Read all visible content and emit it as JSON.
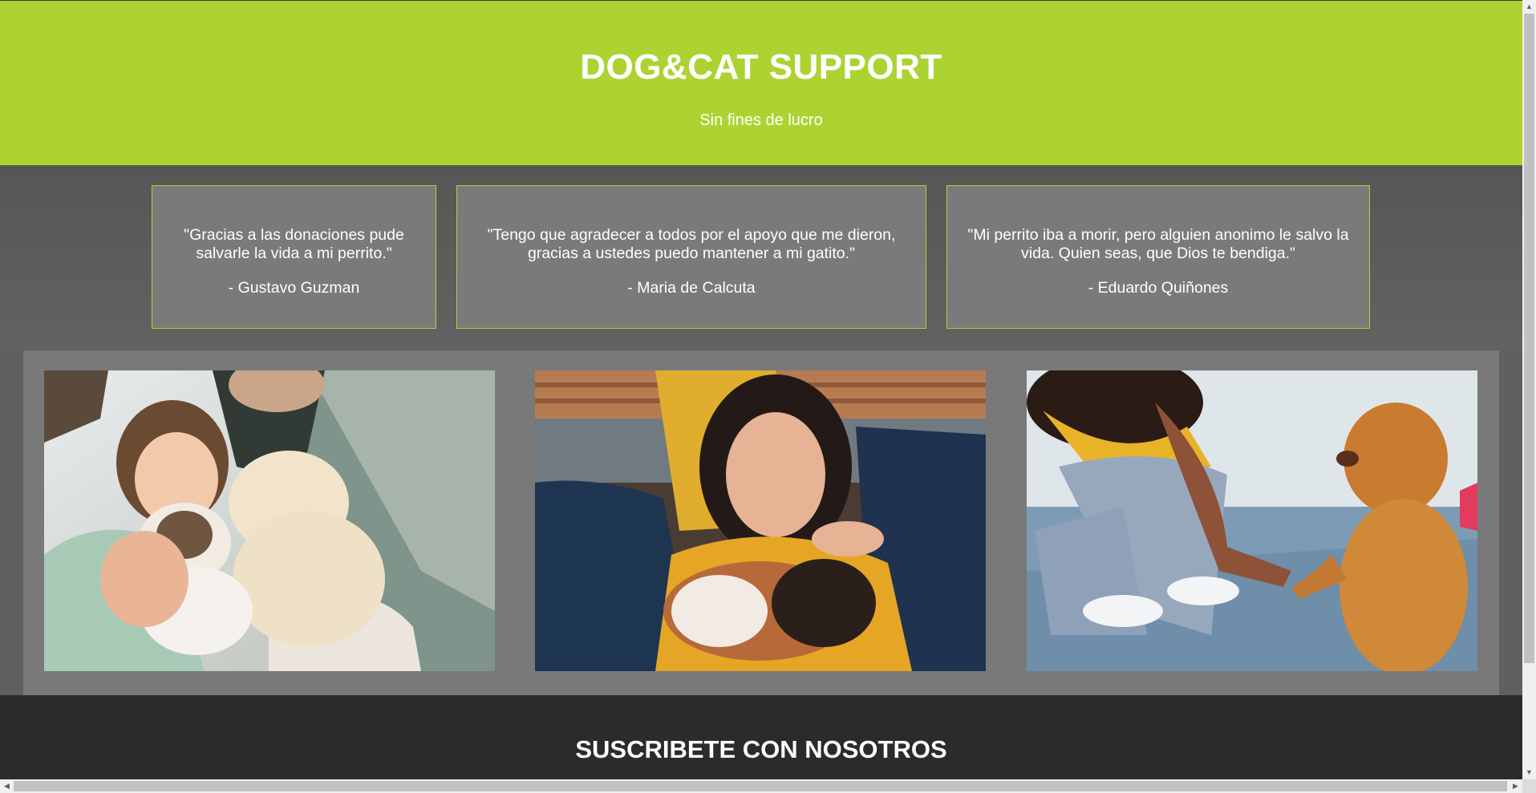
{
  "hero": {
    "title": "DOG&CAT SUPPORT",
    "subtitle": "Sin fines de lucro"
  },
  "testimonials": [
    {
      "quote": "\"Gracias a las donaciones pude salvarle la vida a mi perrito.\"",
      "author": "- Gustavo Guzman"
    },
    {
      "quote": "\"Tengo que agradecer a todos por el apoyo que me dieron, gracias a ustedes puedo mantener a mi gatito.\"",
      "author": "- Maria de Calcuta"
    },
    {
      "quote": "\"Mi perrito iba a morir, pero alguien anonimo le salvo la vida. Quien seas, que Dios te bendiga.\"",
      "author": "- Eduardo Quiñones"
    }
  ],
  "gallery": {
    "photos": [
      {
        "name": "girl-with-puppies-photo"
      },
      {
        "name": "woman-with-beagle-photo"
      },
      {
        "name": "woman-with-spaniel-photo"
      }
    ]
  },
  "subscribe": {
    "title": "SUSCRIBETE CON NOSOTROS"
  },
  "colors": {
    "accent": "#add332",
    "page_background": "#606060",
    "footer_background": "#2b2b2b"
  },
  "icons": {
    "scroll_up": "triangle-up-icon",
    "scroll_down": "triangle-down-icon",
    "scroll_left": "triangle-left-icon",
    "scroll_right": "triangle-right-icon"
  }
}
